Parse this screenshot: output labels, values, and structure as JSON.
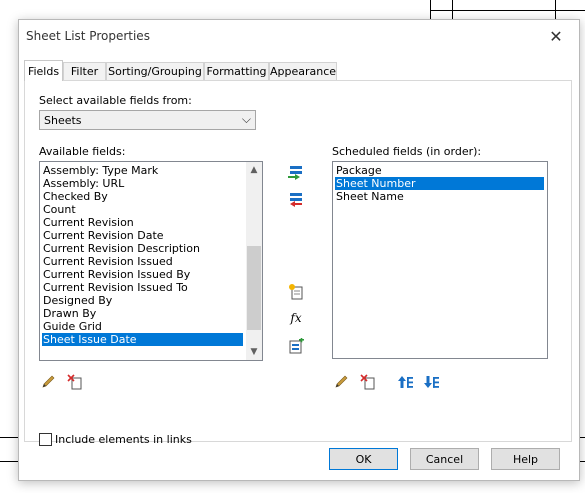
{
  "window": {
    "title": "Sheet List Properties",
    "close_glyph": "✕"
  },
  "tabs": [
    {
      "label": "Fields",
      "active": true
    },
    {
      "label": "Filter"
    },
    {
      "label": "Sorting/Grouping"
    },
    {
      "label": "Formatting"
    },
    {
      "label": "Appearance"
    }
  ],
  "fields_tab": {
    "select_from_label": "Select available fields from:",
    "select_from_value": "Sheets",
    "available_label": "Available fields:",
    "available_fields": [
      "Assembly: Type Mark",
      "Assembly: URL",
      "Checked By",
      "Count",
      "Current Revision",
      "Current Revision Date",
      "Current Revision Description",
      "Current Revision Issued",
      "Current Revision Issued By",
      "Current Revision Issued To",
      "Designed By",
      "Drawn By",
      "Guide Grid",
      "Sheet Issue Date"
    ],
    "available_selected": "Sheet Issue Date",
    "scheduled_label": "Scheduled fields (in order):",
    "scheduled_fields": [
      "Package",
      "Sheet Number",
      "Sheet Name"
    ],
    "scheduled_selected": "Sheet Number",
    "include_links_label": "Include elements in links",
    "include_links_checked": false,
    "icons": {
      "add": "add-parameter-icon",
      "remove": "remove-parameter-icon",
      "new_parameter": "new-parameter-icon",
      "calculated": "calculated-value-icon",
      "combine": "combine-parameters-icon",
      "edit": "edit-parameter-icon",
      "delete": "delete-parameter-icon",
      "move_up": "move-up-icon",
      "move_down": "move-down-icon",
      "fx_glyph": "fx"
    }
  },
  "footer": {
    "ok": "OK",
    "cancel": "Cancel",
    "help": "Help"
  },
  "colors": {
    "selection": "#0078d7",
    "accent_blue": "#1a6fc4",
    "accent_red": "#d52b2b",
    "accent_green": "#2f9a3a"
  }
}
